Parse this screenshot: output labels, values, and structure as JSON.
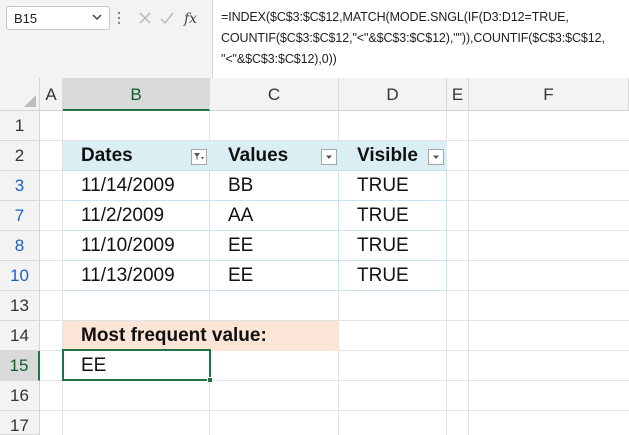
{
  "name_box": "B15",
  "formula_lines": [
    "=INDEX($C$3:$C$12,MATCH(MODE.SNGL(IF(D3:D12=TRUE,",
    "COUNTIF($C$3:$C$12,\"<\"&$C$3:$C$12),\"\")),COUNTIF($C$3:$C$12,",
    "\"<\"&$C$3:$C$12),0))"
  ],
  "columns": [
    "A",
    "B",
    "C",
    "D",
    "E",
    "F"
  ],
  "rows": [
    "1",
    "2",
    "3",
    "7",
    "8",
    "10",
    "13",
    "14",
    "15",
    "16",
    "17"
  ],
  "table": {
    "headers": [
      "Dates",
      "Values",
      "Visible"
    ],
    "rows": [
      [
        "11/14/2009",
        "BB",
        "TRUE"
      ],
      [
        "11/2/2009",
        "AA",
        "TRUE"
      ],
      [
        "11/10/2009",
        "EE",
        "TRUE"
      ],
      [
        "11/13/2009",
        "EE",
        "TRUE"
      ]
    ]
  },
  "label": "Most frequent value:",
  "result": "EE",
  "colors": {
    "accent": "#217346",
    "table_header": "#dbeef4",
    "label_fill": "#fce4d6",
    "filtered_row_number": "#1f5fc4"
  },
  "icons": {
    "name_box_dropdown": "chevron-down-icon",
    "cancel": "x-icon",
    "enter": "check-icon",
    "insert_function": "fx-icon",
    "filter_active": "filter-icon",
    "dropdown": "dropdown-arrow-icon"
  }
}
